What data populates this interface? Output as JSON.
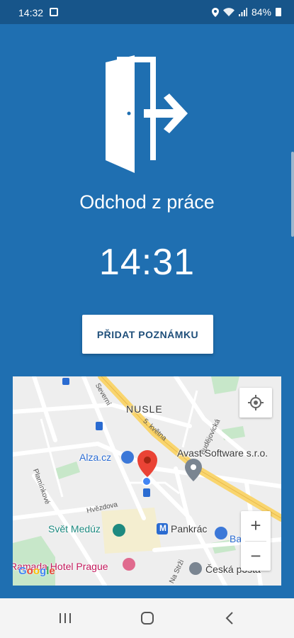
{
  "status_bar": {
    "time": "14:32",
    "battery": "84%",
    "icons": [
      "notification-icon",
      "location-icon",
      "wifi-icon",
      "signal-icon",
      "battery-icon"
    ]
  },
  "screen": {
    "icon": "exit-door-icon",
    "title": "Odchod z práce",
    "time": "14:31",
    "note_button_label": "PŘIDAT POZNÁMKU"
  },
  "map": {
    "area_label": "NUSLE",
    "places": {
      "alza": "Alza.cz",
      "avast": "Avast Software s.r.o.",
      "svet_meduz": "Svět Medúz",
      "pankrac": "Pankrác",
      "bauhaus": "Bauhaus",
      "hotel": "Ramada Hotel Prague",
      "ceska_posta": "Česká pošta",
      "metro": "M"
    },
    "streets": {
      "kvetna": "5. května",
      "sevcerna": "Severní",
      "plamenska": "Plamínkové",
      "hvezdova": "Hvězdova",
      "na_strzi": "Na Strži",
      "budejovicka": "Budějovická"
    },
    "zoom_in": "+",
    "zoom_out": "−",
    "attribution": "Google",
    "colors": {
      "road_major": "#F9D56E",
      "park": "#C7E7C9",
      "water": "#AADAFF",
      "marker": "#EA4335",
      "location_dot": "#4285F4"
    }
  },
  "nav": {
    "recent_icon": "recent-apps-icon",
    "home_icon": "home-icon",
    "back_icon": "back-icon"
  },
  "colors": {
    "background": "#1F6FB1",
    "status_bar": "#17558A",
    "button_text": "#1F4F7A"
  }
}
